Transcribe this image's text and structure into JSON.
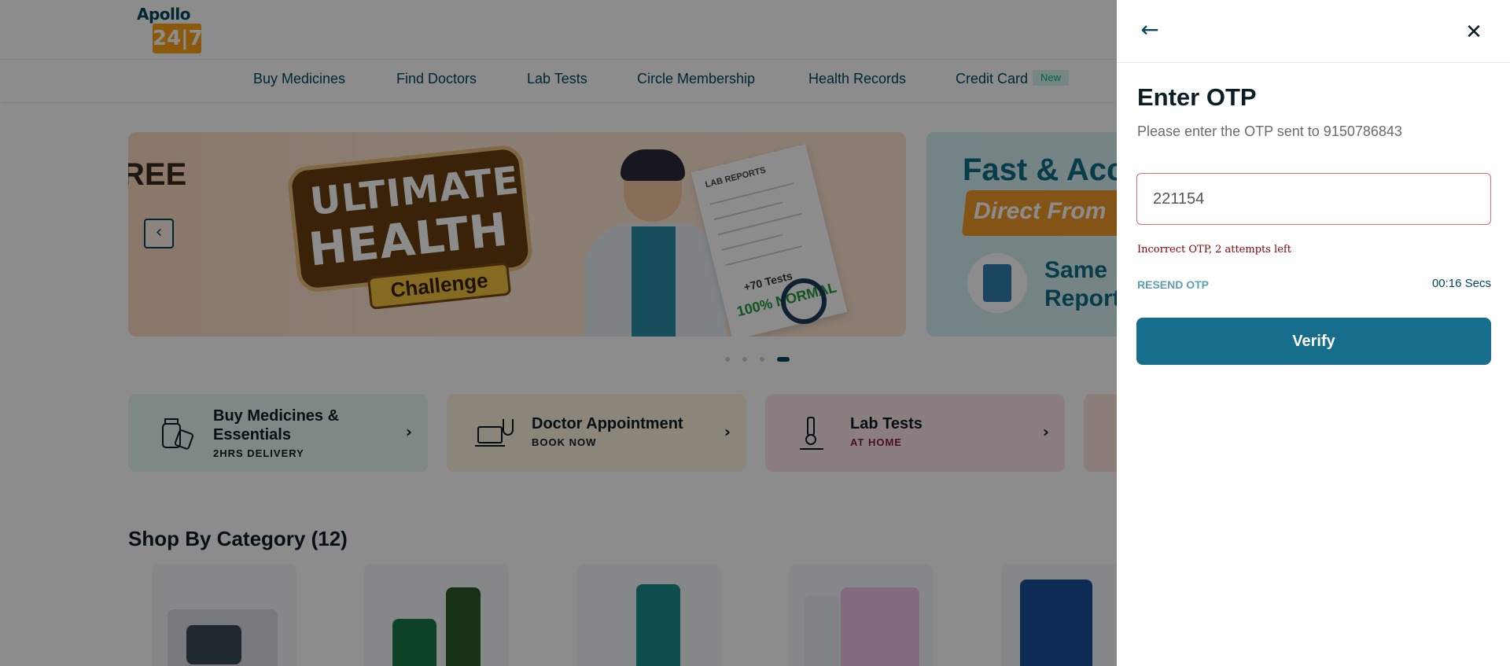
{
  "brand": {
    "logo_top": "Apollo",
    "logo_box": "24|7"
  },
  "nav": {
    "items": [
      {
        "label": "Buy Medicines"
      },
      {
        "label": "Find Doctors"
      },
      {
        "label": "Lab Tests"
      },
      {
        "label": "Circle Membership"
      },
      {
        "label": "Health Records"
      },
      {
        "label": "Credit Card",
        "badge": "New"
      }
    ]
  },
  "carousel": {
    "banner1": {
      "left_text": "REE",
      "headline_line1": "ULTIMATE",
      "headline_line2": "HEALTH",
      "headline_tag": "Challenge",
      "report_title": "LAB REPORTS",
      "report_tests": "+70 Tests",
      "report_stamp": "100% NORMAL"
    },
    "banner2": {
      "title": "Fast & Acc",
      "ribbon": "Direct From",
      "text_line1": "Same",
      "text_line2": "Report"
    },
    "prev_icon": "chevron-left-icon",
    "dots_count": 4,
    "active_dot": 4
  },
  "services": [
    {
      "title_line1": "Buy Medicines &",
      "title_line2": "Essentials",
      "subtitle": "2HRS DELIVERY",
      "icon": "medicine-bottle-icon",
      "bg": "#e6f7f3",
      "sub_color": "#0b1e26"
    },
    {
      "title_line1": "Doctor Appointment",
      "title_line2": "",
      "subtitle": "BOOK NOW",
      "icon": "doctor-laptop-icon",
      "bg": "#fdf3de",
      "sub_color": "#0b1e26"
    },
    {
      "title_line1": "Lab Tests",
      "title_line2": "",
      "subtitle": "AT HOME",
      "icon": "microscope-icon",
      "bg": "#fbe6ec",
      "sub_color": "#8a1d3b"
    }
  ],
  "category": {
    "title": "Shop By Category (12)"
  },
  "otp": {
    "title": "Enter OTP",
    "subtitle": "Please enter the OTP sent to 9150786843",
    "input_value": "221154",
    "error": "Incorrect OTP, 2 attempts left",
    "resend": "RESEND OTP",
    "timer": "00:16 Secs",
    "verify": "Verify",
    "back_icon": "arrow-left-icon",
    "close_icon": "close-icon"
  },
  "colors": {
    "brand": "#02475b",
    "accent": "#fca317",
    "verify_bg": "#166d8c",
    "error": "#8b0000",
    "input_error_border": "#e06c6c"
  }
}
